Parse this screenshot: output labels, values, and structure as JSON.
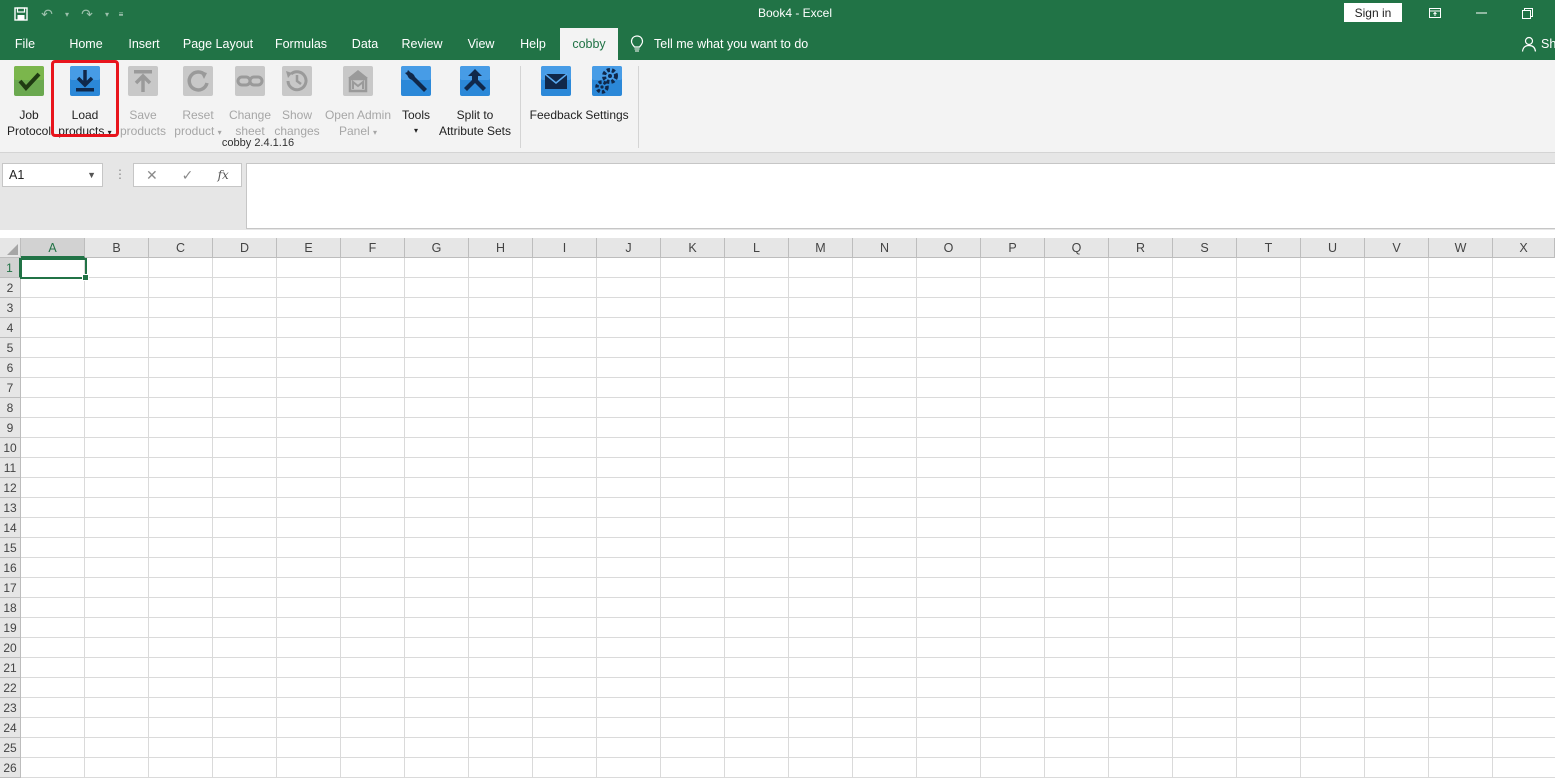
{
  "window": {
    "title": "Book4  -  Excel",
    "sign_in_label": "Sign in"
  },
  "ribbon_tabs": [
    "File",
    "Home",
    "Insert",
    "Page Layout",
    "Formulas",
    "Data",
    "Review",
    "View",
    "Help",
    "cobby"
  ],
  "active_tab": "cobby",
  "tell_me": "Tell me what you want to do",
  "share_label": "Sh",
  "ribbon": {
    "group_label": "cobby 2.4.1.16",
    "buttons": {
      "job_protocol": {
        "line1": "Job",
        "line2": "Protocol",
        "icon": "check-icon"
      },
      "load_products": {
        "line1": "Load",
        "line2": "products",
        "icon": "download-icon"
      },
      "save_products": {
        "line1": "Save",
        "line2": "products",
        "icon": "upload-icon"
      },
      "reset_product": {
        "line1": "Reset",
        "line2": "product",
        "icon": "reset-icon"
      },
      "change_sheet": {
        "line1": "Change",
        "line2": "sheet",
        "icon": "chain-icon"
      },
      "show_changes": {
        "line1": "Show",
        "line2": "changes",
        "icon": "history-icon"
      },
      "open_admin_panel": {
        "line1": "Open Admin",
        "line2": "Panel",
        "icon": "admin-icon"
      },
      "tools": {
        "line1": "Tools",
        "icon": "wrench-icon"
      },
      "split_attribute_sets": {
        "line1": "Split to",
        "line2": "Attribute Sets",
        "icon": "split-icon"
      },
      "feedback": {
        "line1": "Feedback",
        "icon": "mail-icon"
      },
      "settings": {
        "line1": "Settings",
        "icon": "gears-icon"
      }
    }
  },
  "formula_bar": {
    "name_box": "A1",
    "formula": ""
  },
  "sheet": {
    "columns": [
      "A",
      "B",
      "C",
      "D",
      "E",
      "F",
      "G",
      "H",
      "I",
      "J",
      "K",
      "L",
      "M",
      "N",
      "O",
      "P",
      "Q",
      "R",
      "S",
      "T",
      "U",
      "V",
      "W",
      "X"
    ],
    "rows": [
      "1",
      "2",
      "3",
      "4",
      "5",
      "6",
      "7",
      "8",
      "9",
      "10",
      "11",
      "12",
      "13",
      "14",
      "15",
      "16",
      "17",
      "18",
      "19",
      "20",
      "21",
      "22",
      "23",
      "24",
      "25",
      "26"
    ],
    "selected_cell": "A1"
  }
}
